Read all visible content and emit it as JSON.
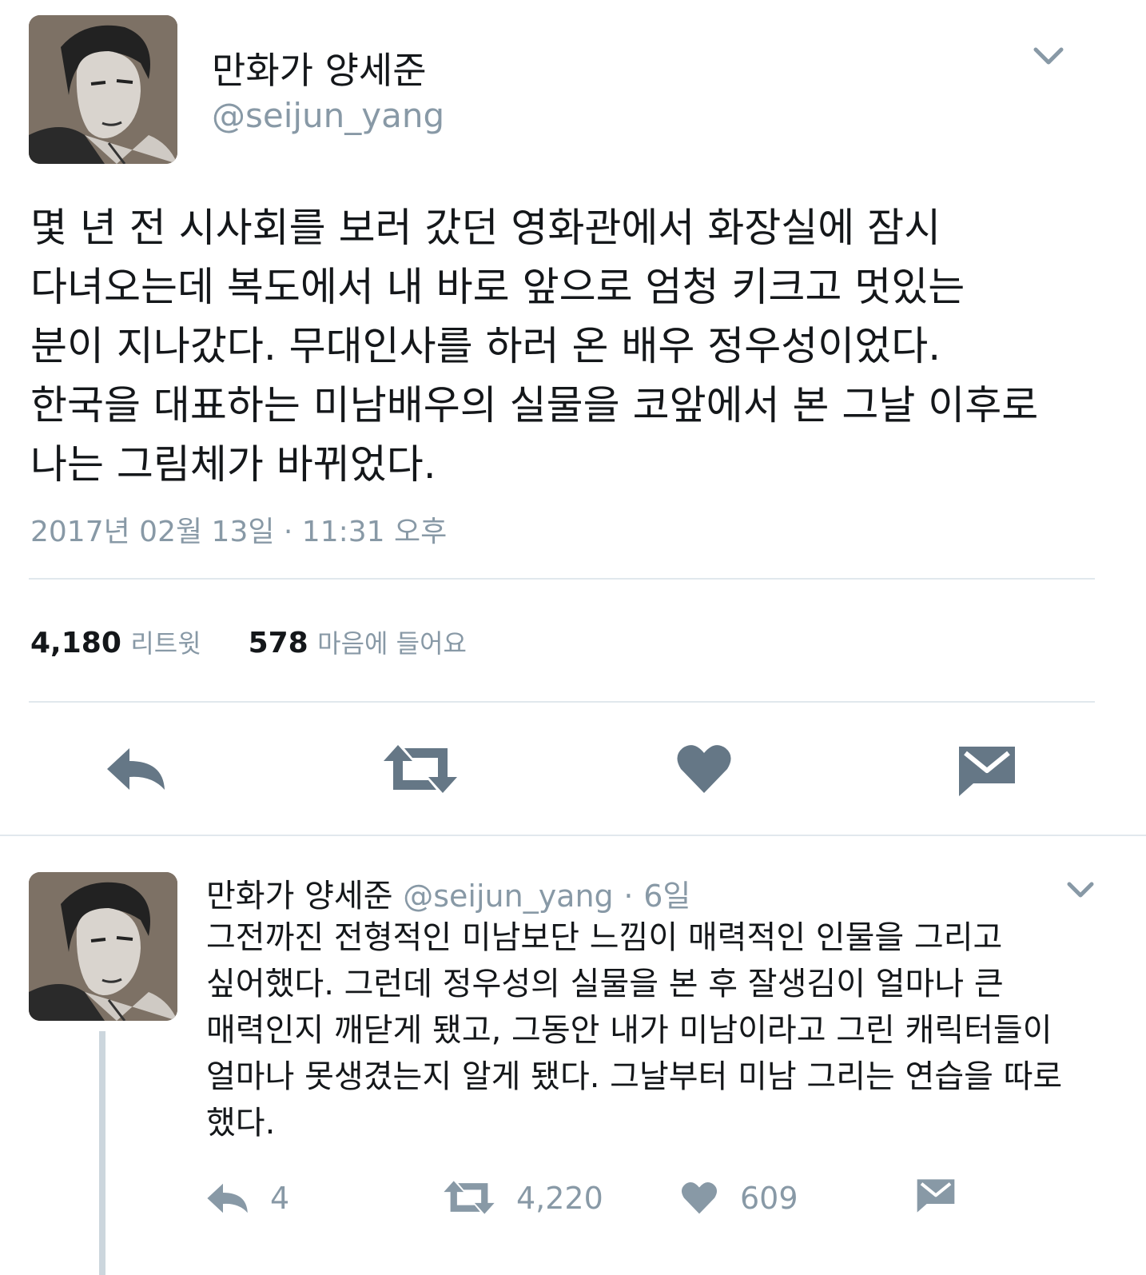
{
  "main_tweet": {
    "author_name": "만화가 양세준",
    "handle": "@seijun_yang",
    "caret_icon": "chevron-down-icon",
    "text_lines": [
      "몇 년 전 시사회를 보러 갔던 영화관에서 화장실에 잠시",
      "다녀오는데 복도에서 내 바로 앞으로 엄청 키크고 멋있는",
      "분이 지나갔다. 무대인사를 하러 온 배우 정우성이었다.",
      "한국을 대표하는 미남배우의 실물을 코앞에서 본 그날 이후로",
      "나는 그림체가 바뀌었다."
    ],
    "timestamp": "2017년 02월 13일 · 11:31 오후",
    "stats": {
      "retweets_count": "4,180",
      "retweets_label": "리트윗",
      "likes_count": "578",
      "likes_label": "마음에 들어요"
    },
    "actions": [
      "reply-icon",
      "retweet-icon",
      "heart-icon",
      "message-icon"
    ]
  },
  "reply_tweet": {
    "author_name": "만화가 양세준",
    "handle": "@seijun_yang",
    "separator": "·",
    "age": "6일",
    "caret_icon": "chevron-down-icon",
    "text_lines": [
      "그전까진 전형적인 미남보단 느낌이 매력적인 인물을 그리고",
      "싶어했다. 그런데 정우성의 실물을 본 후 잘생김이 얼마나 큰",
      "매력인지 깨닫게 됐고, 그동안 내가 미남이라고 그린 캐릭터들이",
      "얼마나 못생겼는지 알게 됐다. 그날부터 미남 그리는 연습을 따로",
      "했다."
    ],
    "actions": {
      "reply_count": "4",
      "retweet_count": "4,220",
      "like_count": "609"
    }
  },
  "colors": {
    "text": "#14171a",
    "secondary": "#8899a6",
    "icon": "#657786",
    "divider": "#e1e8ed"
  }
}
